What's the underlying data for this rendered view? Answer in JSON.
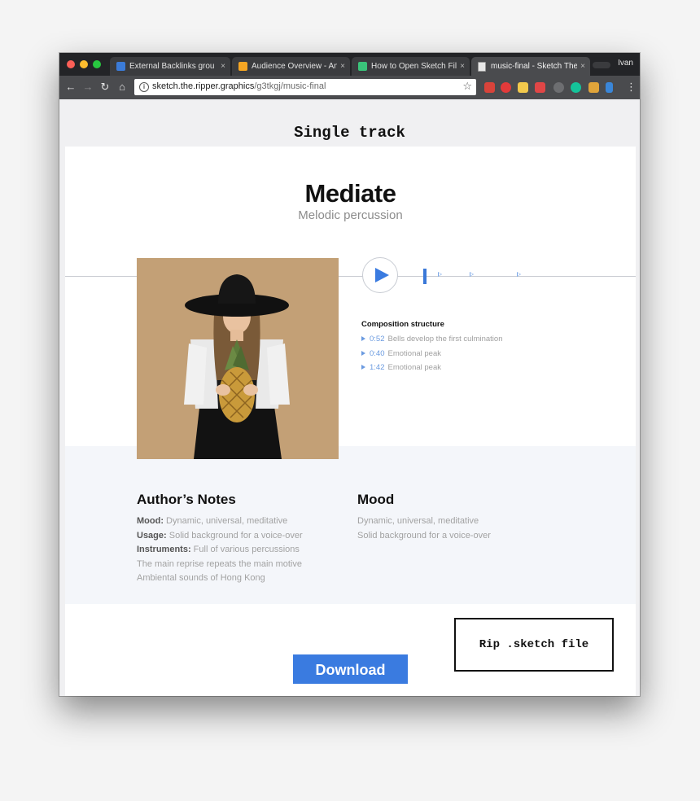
{
  "browser": {
    "tabs": [
      {
        "title": "External Backlinks grou",
        "favicon_color": "#3b7bd8"
      },
      {
        "title": "Audience Overview - An",
        "favicon_color": "#f6a623"
      },
      {
        "title": "How to Open Sketch Fil",
        "favicon_color": "#3ac37a"
      },
      {
        "title": "music-final - Sketch The",
        "favicon_color": "#e8e8e8"
      }
    ],
    "close_glyph": "×",
    "profile_name": "Ivan",
    "url_host": "sketch.the.ripper.graphics",
    "url_path": "/g3tkgj/music-final",
    "extension_icons": [
      "ext-red-icon",
      "pinterest-icon",
      "bookmark-star-icon",
      "red-square-icon",
      "info-circle-icon",
      "grammarly-icon",
      "k-icon",
      "feather-icon"
    ]
  },
  "page": {
    "heading": "Single track",
    "track": {
      "title": "Mediate",
      "subtitle": "Melodic percussion"
    },
    "composition": {
      "title": "Composition structure",
      "items": [
        {
          "time": "0:52",
          "label": "Bells develop the first culmination"
        },
        {
          "time": "0:40",
          "label": "Emotional peak"
        },
        {
          "time": "1:42",
          "label": "Emotional peak"
        }
      ]
    },
    "author_notes": {
      "heading": "Author’s Notes",
      "lines": [
        {
          "key": "Mood:",
          "value": " Dynamic, universal, meditative"
        },
        {
          "key": "Usage:",
          "value": " Solid background for a voice-over"
        },
        {
          "key": "Instruments:",
          "value": " Full of various percussions"
        },
        {
          "key": "",
          "value": "The main reprise repeats the main motive"
        },
        {
          "key": "",
          "value": "Ambiental sounds of Hong Kong"
        }
      ]
    },
    "mood": {
      "heading": "Mood",
      "lines": [
        "Dynamic, universal, meditative",
        "Solid background for a voice-over"
      ]
    },
    "download_label": "Download",
    "rip_label": "Rip .sketch file"
  },
  "colors": {
    "accent": "#3a7be0",
    "chrome_dark": "#232427"
  }
}
